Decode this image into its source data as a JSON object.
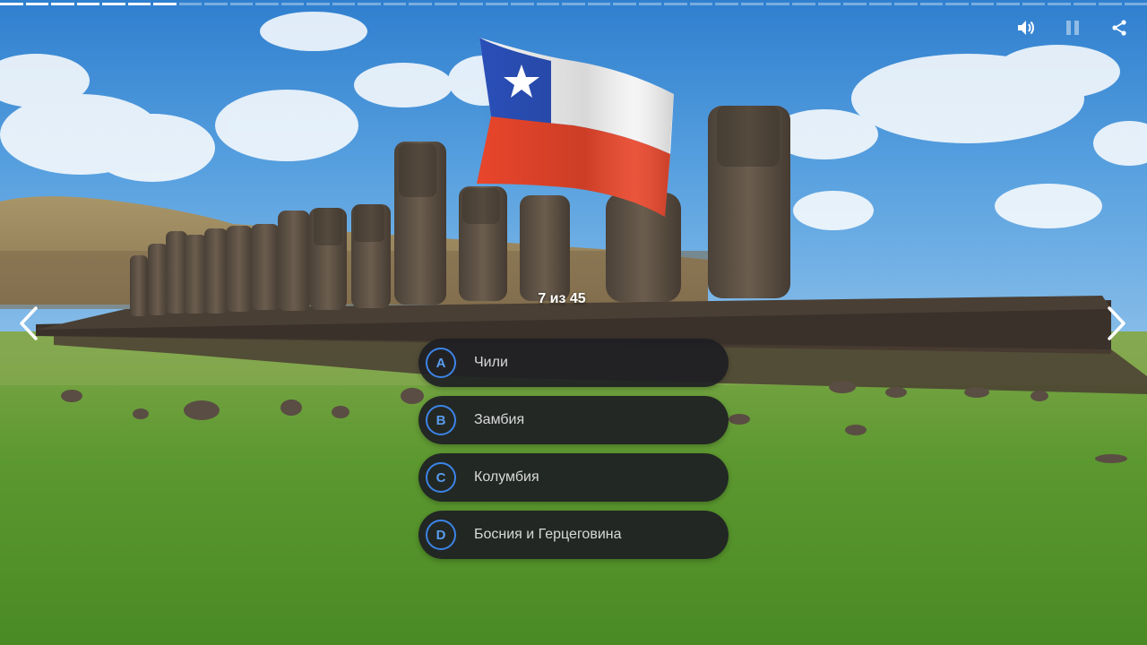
{
  "progress": {
    "current": 7,
    "total": 45
  },
  "counter": {
    "text": "7 из 45"
  },
  "controls": {
    "sound_icon": "speaker-icon",
    "pause_icon": "pause-icon",
    "share_icon": "share-icon"
  },
  "nav": {
    "prev_icon": "chevron-left-icon",
    "next_icon": "chevron-right-icon"
  },
  "image": {
    "flag": "chile-flag",
    "scene": "moai-statues-easter-island"
  },
  "answers": [
    {
      "letter": "A",
      "label": "Чили"
    },
    {
      "letter": "B",
      "label": "Замбия"
    },
    {
      "letter": "C",
      "label": "Колумбия"
    },
    {
      "letter": "D",
      "label": "Босния и Герцеговина"
    }
  ],
  "colors": {
    "accent": "#3c84e6",
    "answer_bg": "#1e1f23",
    "answer_text": "#d9d9d9",
    "flag_red": "#e8462b",
    "flag_blue": "#2a4fb8",
    "flag_white": "#f5f5f5"
  }
}
